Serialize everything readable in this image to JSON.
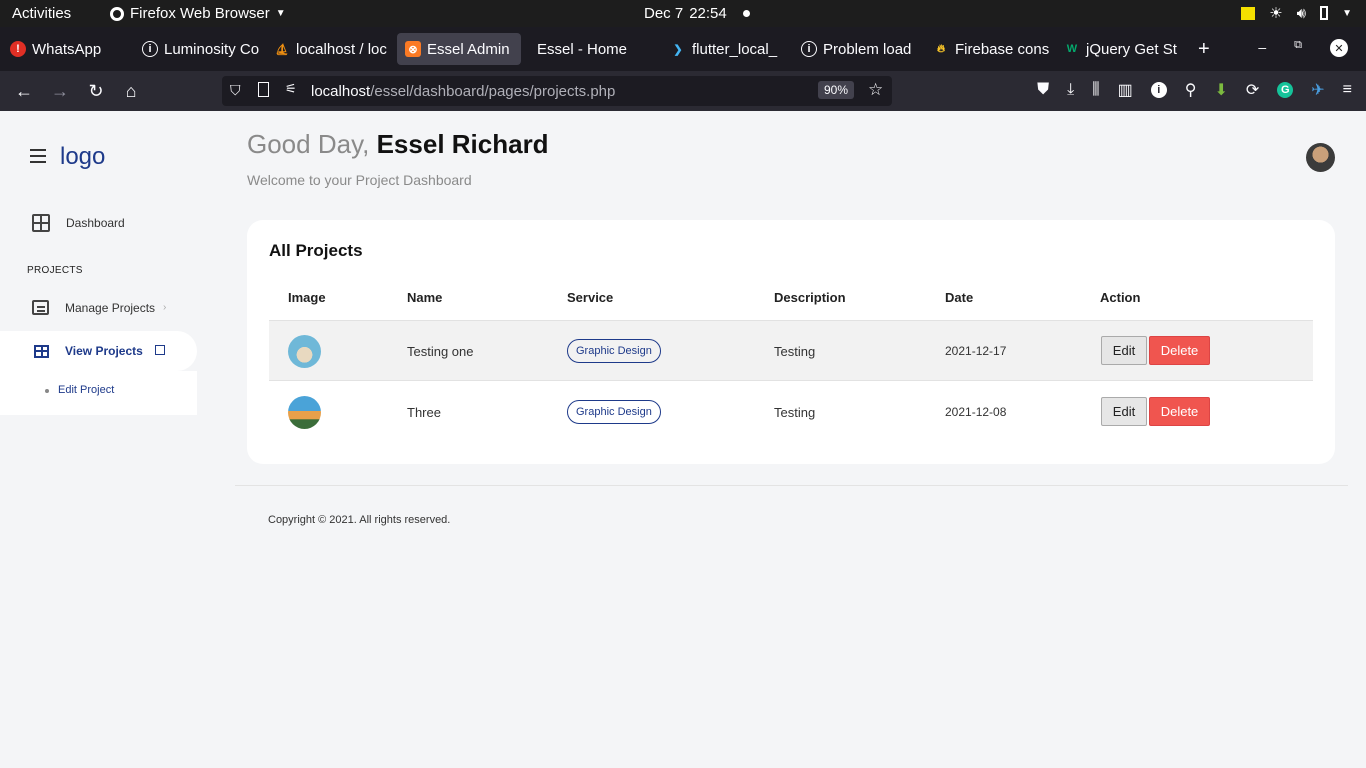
{
  "system": {
    "activities": "Activities",
    "app_menu": "Firefox Web Browser",
    "date": "Dec 7",
    "time": "22:54"
  },
  "tabs": [
    {
      "label": "WhatsApp",
      "icon": "whatsapp-icon",
      "color": "#e02f25"
    },
    {
      "label": "Luminosity Co",
      "icon": "info-icon",
      "color": "#fbfbfe"
    },
    {
      "label": "localhost / loc",
      "icon": "phpmyadmin-icon",
      "color": "#f29111"
    },
    {
      "label": "Essel Admin",
      "icon": "xampp-icon",
      "color": "#fb7a24",
      "active": true
    },
    {
      "label": "Essel - Home",
      "icon": "blank-icon",
      "color": "#1c1b22"
    },
    {
      "label": "flutter_local_",
      "icon": "flutter-icon",
      "color": "#44b5f3"
    },
    {
      "label": "Problem load",
      "icon": "info-icon",
      "color": "#fbfbfe"
    },
    {
      "label": "Firebase cons",
      "icon": "firebase-icon",
      "color": "#ffca28"
    },
    {
      "label": "jQuery Get St",
      "icon": "w3schools-icon",
      "color": "#04aa6d"
    }
  ],
  "urlbar": {
    "host": "localhost",
    "path": "/essel/dashboard/pages/projects.php",
    "zoom": "90%"
  },
  "sidebar": {
    "logo": "logo",
    "dashboard": "Dashboard",
    "section": "PROJECTS",
    "manage": "Manage Projects",
    "view": "View Projects",
    "sub": "Edit Project"
  },
  "header": {
    "greeting": "Good Day,",
    "name": "Essel Richard",
    "welcome": "Welcome to your Project Dashboard"
  },
  "card": {
    "title": "All Projects",
    "columns": [
      "Image",
      "Name",
      "Service",
      "Description",
      "Date",
      "Action"
    ],
    "rows": [
      {
        "name": "Testing one",
        "service": "Graphic Design",
        "description": "Testing",
        "date": "2021-12-17",
        "edit": "Edit",
        "delete": "Delete"
      },
      {
        "name": "Three",
        "service": "Graphic Design",
        "description": "Testing",
        "date": "2021-12-08",
        "edit": "Edit",
        "delete": "Delete"
      }
    ]
  },
  "footer": {
    "copyright": "Copyright © 2021. All rights reserved."
  },
  "colors": {
    "accent": "#1e3a8a",
    "danger": "#f0554f"
  }
}
